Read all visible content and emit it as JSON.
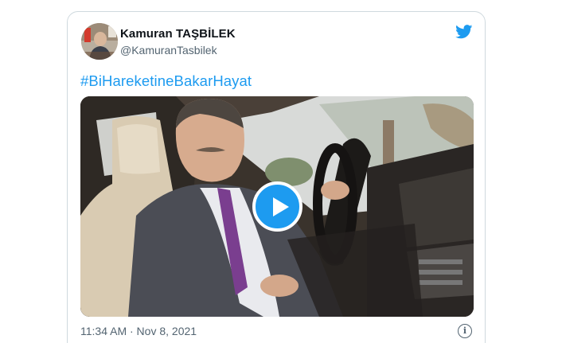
{
  "tweet": {
    "author_name": "Kamuran TAŞBİLEK",
    "author_handle": "@KamuranTasbilek",
    "text": "#BiHareketineBakarHayat",
    "timestamp": "11:34 AM · Nov 8, 2021",
    "info_glyph": "i"
  },
  "icons": {
    "brand": "twitter-bird-icon",
    "play": "play-icon",
    "info": "info-icon"
  },
  "colors": {
    "brand_blue": "#1d9bf0",
    "text_primary": "#0f1419",
    "text_secondary": "#536471",
    "border": "#cfd9de"
  }
}
